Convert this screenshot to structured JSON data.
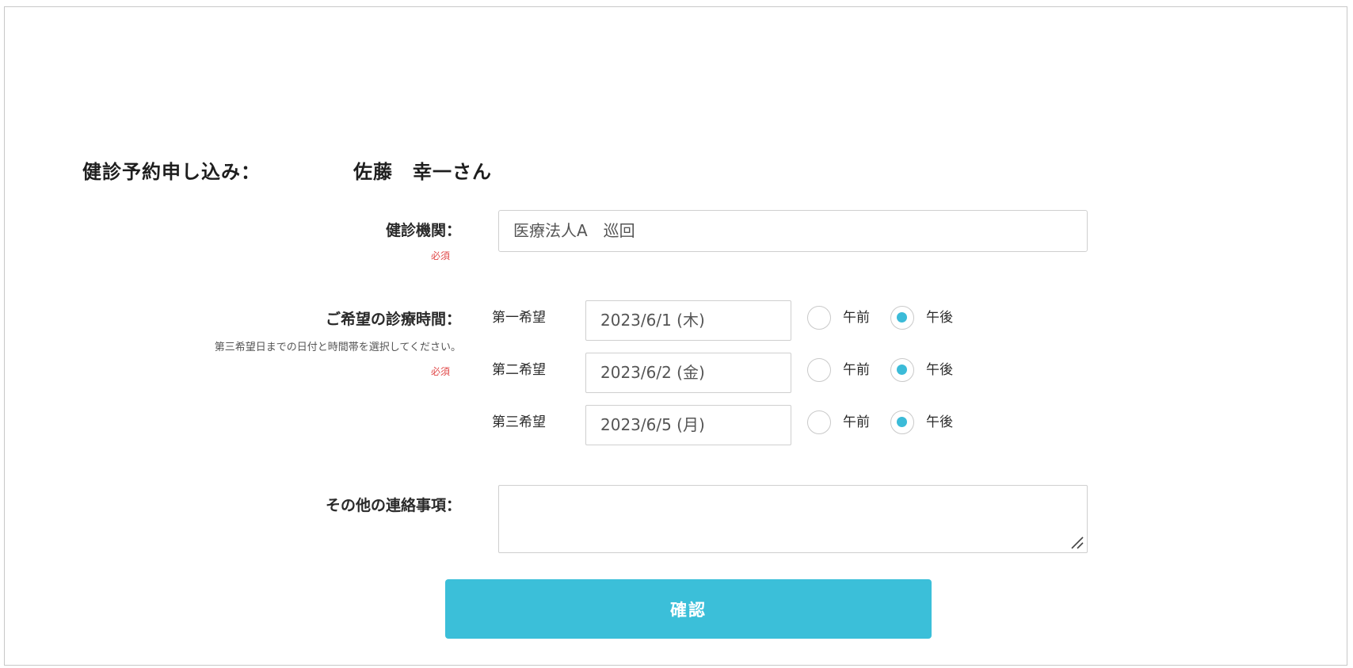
{
  "header": {
    "title": "健診予約申し込み：",
    "patient_name": "佐藤　幸一さん"
  },
  "institution": {
    "label": "健診機関：",
    "required": "必須",
    "value": "医療法人A　巡回"
  },
  "schedule": {
    "label": "ご希望の診療時間：",
    "hint": "第三希望日までの日付と時間帯を選択してください。",
    "required": "必須",
    "options": {
      "am": "午前",
      "pm": "午後"
    },
    "choices": [
      {
        "label": "第一希望",
        "date": "2023/6/1 (木)",
        "selected": "pm"
      },
      {
        "label": "第二希望",
        "date": "2023/6/2 (金)",
        "selected": "pm"
      },
      {
        "label": "第三希望",
        "date": "2023/6/5 (月)",
        "selected": "pm"
      }
    ]
  },
  "notes": {
    "label": "その他の連絡事項：",
    "value": ""
  },
  "actions": {
    "confirm_label": "確認"
  },
  "colors": {
    "accent": "#3bbfd9",
    "required": "#e04848"
  }
}
